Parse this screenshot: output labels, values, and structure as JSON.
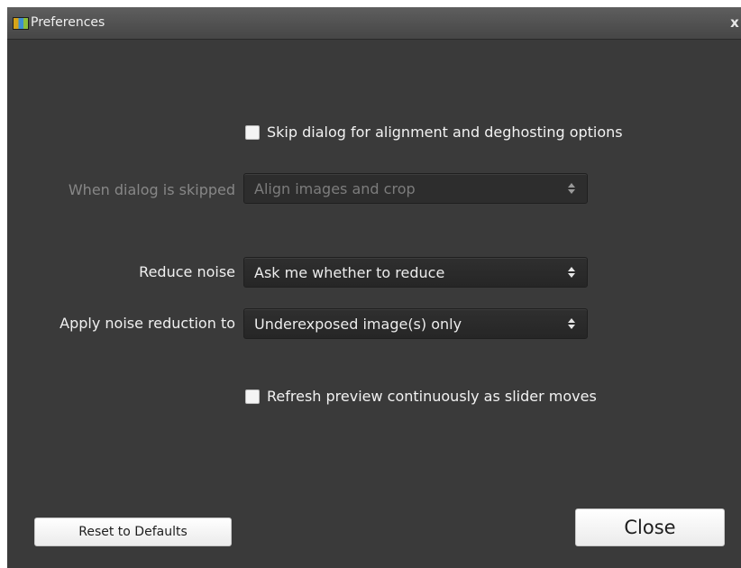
{
  "window": {
    "title": "Preferences",
    "close_glyph": "x"
  },
  "options": {
    "skip_dialog": {
      "label": "Skip dialog for alignment and deghosting options",
      "checked": false
    },
    "when_skipped": {
      "label": "When dialog is skipped",
      "value": "Align images and crop",
      "enabled": false
    },
    "reduce_noise": {
      "label": "Reduce noise",
      "value": "Ask me whether to reduce"
    },
    "apply_noise_reduction": {
      "label": "Apply noise reduction to",
      "value": "Underexposed image(s) only"
    },
    "refresh_preview": {
      "label": "Refresh preview continuously as slider moves",
      "checked": false
    }
  },
  "buttons": {
    "reset": "Reset to Defaults",
    "close": "Close"
  },
  "icons": {
    "app": "app-icon",
    "close": "close-icon",
    "select_arrows": "up-down-arrows-icon"
  }
}
